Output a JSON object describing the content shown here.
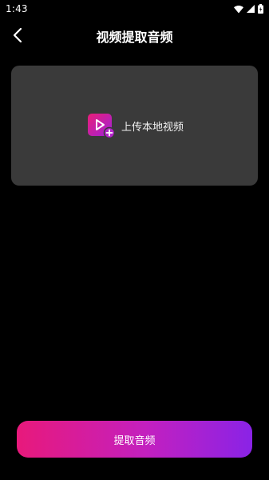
{
  "status_bar": {
    "time": "1:43",
    "icons": [
      "wifi-icon",
      "signal-icon",
      "battery-icon"
    ]
  },
  "header": {
    "title": "视频提取音频",
    "back_icon": "chevron-left-icon"
  },
  "upload": {
    "label": "上传本地视频",
    "icon": "video-add-icon",
    "colors": {
      "card": "#3a3a3a",
      "icon_start": "#e91e78",
      "icon_end": "#a021d8"
    }
  },
  "action": {
    "label": "提取音频",
    "colors": {
      "start": "#e8197b",
      "end": "#8a23e6"
    }
  }
}
